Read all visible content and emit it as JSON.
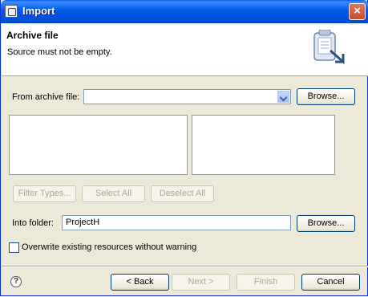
{
  "window": {
    "title": "Import",
    "close_label": "×"
  },
  "banner": {
    "title": "Archive file",
    "message": "Source must not be empty."
  },
  "source": {
    "label": "From archive file:",
    "value": "",
    "browse_label": "Browse..."
  },
  "selection": {
    "filter_label": "Filter Types...",
    "select_all_label": "Select All",
    "deselect_all_label": "Deselect All"
  },
  "destination": {
    "label": "Into folder:",
    "value": "ProjectH",
    "browse_label": "Browse..."
  },
  "options": {
    "overwrite_label": "Overwrite existing resources without warning",
    "overwrite_checked": false
  },
  "footer": {
    "help_glyph": "?",
    "back_label": "< Back",
    "next_label": "Next >",
    "finish_label": "Finish",
    "cancel_label": "Cancel"
  }
}
